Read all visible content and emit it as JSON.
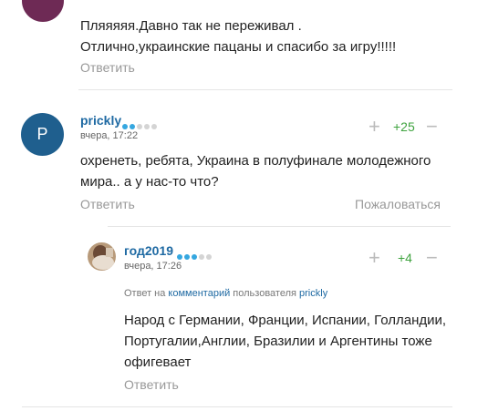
{
  "comments": [
    {
      "text": "Пляяяяя.Давно так не переживал . Отлично,украинские пацаны и спасибо за игру!!!!!",
      "reply_label": "Ответить"
    },
    {
      "avatar_letter": "P",
      "username": "prickly",
      "rating_dots": 2,
      "date": "вчера, 17:22",
      "score": "+25",
      "text": "охренеть, ребята, Украина в полуфинале молодежного мира.. а у нас-то что?",
      "reply_label": "Ответить",
      "report_label": "Пожаловаться"
    },
    {
      "username": "год2019",
      "rating_dots": 3,
      "date": "вчера, 17:26",
      "score": "+4",
      "reply_to_prefix": "Ответ на",
      "reply_to_link": "комментарий",
      "reply_to_middle": "пользователя",
      "reply_to_user": "prickly",
      "text": "Народ с Германии, Франции, Испании, Голландии, Португалии,Англии, Бразилии и Аргентины тоже офигевает",
      "reply_label": "Ответить"
    }
  ],
  "icons": {
    "plus": "plus-icon",
    "minus": "minus-icon"
  },
  "colors": {
    "username": "#1f6aa3",
    "score": "#3fa33f",
    "dot_active": "#35a7e0",
    "dot_inactive": "#d4d4d4"
  }
}
